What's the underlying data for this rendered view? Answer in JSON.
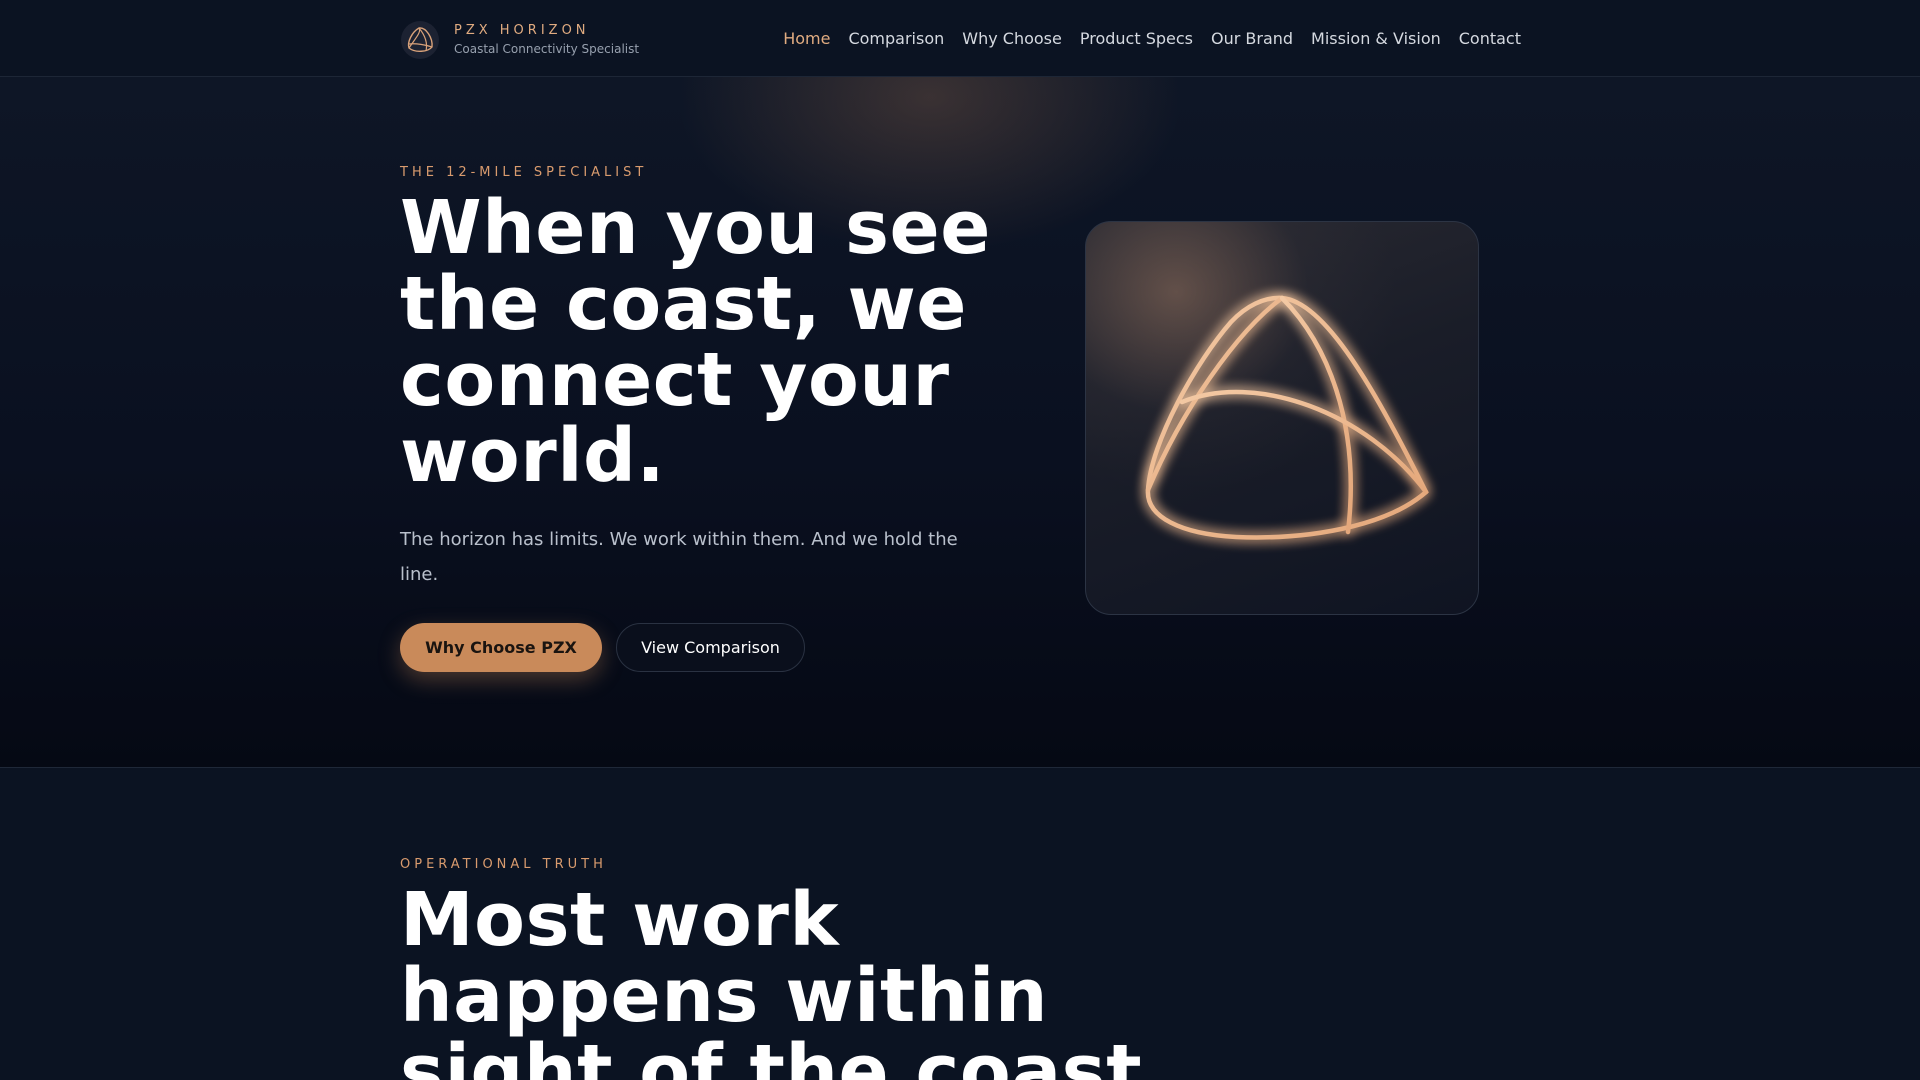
{
  "header": {
    "brand_name": "PZX HORIZON",
    "brand_tagline": "Coastal Connectivity Specialist",
    "logo_icon": "tri-orbit-logo",
    "nav": [
      {
        "label": "Home",
        "active": true
      },
      {
        "label": "Comparison",
        "active": false
      },
      {
        "label": "Why Choose",
        "active": false
      },
      {
        "label": "Product Specs",
        "active": false
      },
      {
        "label": "Our Brand",
        "active": false
      },
      {
        "label": "Mission & Vision",
        "active": false
      },
      {
        "label": "Contact",
        "active": false
      }
    ]
  },
  "hero": {
    "eyebrow": "THE 12-MILE SPECIALIST",
    "title": "When you see the coast, we connect your world.",
    "subtitle": "The horizon has limits. We work within them. And we hold the line.",
    "primary_button": "Why Choose PZX",
    "secondary_button": "View Comparison",
    "card_icon": "glowing-tri-orbit-emblem"
  },
  "section2": {
    "eyebrow": "OPERATIONAL TRUTH",
    "title": "Most work happens within sight of the coast."
  },
  "colors": {
    "accent": "#e0ab80",
    "button": "#c98a5a",
    "background": "#0b1322"
  }
}
